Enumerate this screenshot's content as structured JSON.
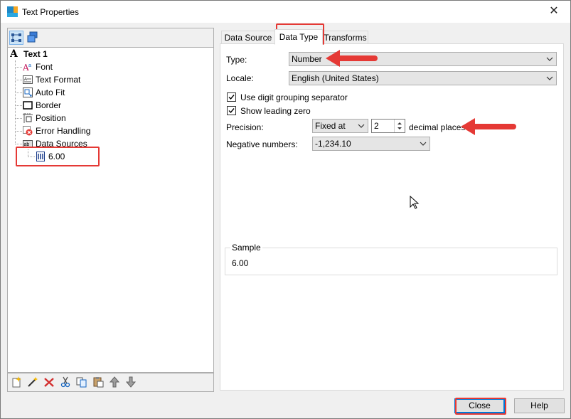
{
  "window": {
    "title": "Text Properties",
    "close_glyph": "✕"
  },
  "tree": {
    "root_label": "Text 1",
    "items": [
      {
        "label": "Font",
        "icon": "font-icon"
      },
      {
        "label": "Text Format",
        "icon": "text-format-icon"
      },
      {
        "label": "Auto Fit",
        "icon": "auto-fit-icon"
      },
      {
        "label": "Border",
        "icon": "border-icon"
      },
      {
        "label": "Position",
        "icon": "position-icon"
      },
      {
        "label": "Error Handling",
        "icon": "error-handling-icon"
      },
      {
        "label": "Data Sources",
        "icon": "data-sources-icon"
      }
    ],
    "child": {
      "label": "6.00",
      "icon": "data-source-item-icon"
    }
  },
  "tabs": [
    {
      "label": "Data Source",
      "active": false
    },
    {
      "label": "Data Type",
      "active": true
    },
    {
      "label": "Transforms",
      "active": false
    }
  ],
  "form": {
    "type_label": "Type:",
    "type_value": "Number",
    "locale_label": "Locale:",
    "locale_value": "English (United States)",
    "digit_grouping_label": "Use digit grouping separator",
    "digit_grouping_checked": true,
    "leading_zero_label": "Show leading zero",
    "leading_zero_checked": true,
    "precision_label": "Precision:",
    "precision_mode": "Fixed at",
    "precision_value": "2",
    "decimal_places_label": "decimal places",
    "negative_label": "Negative numbers:",
    "negative_value": "-1,234.10"
  },
  "sample": {
    "title": "Sample",
    "value": "6.00"
  },
  "buttons": {
    "close": "Close",
    "help": "Help"
  },
  "annotation_color": "#e53935"
}
